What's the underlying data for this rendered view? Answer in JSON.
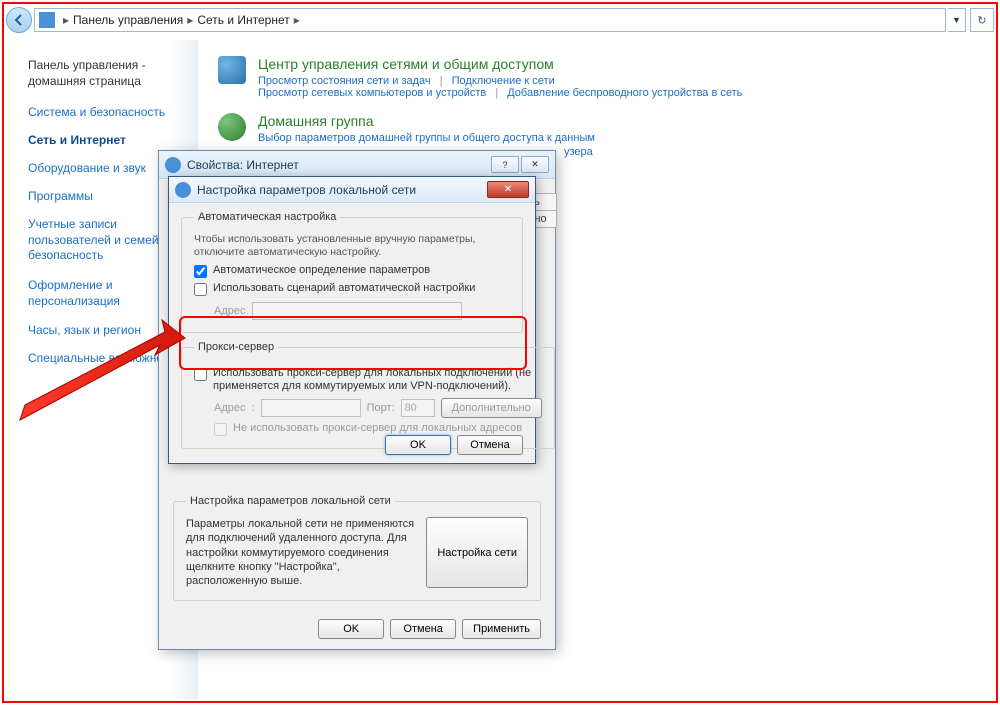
{
  "breadcrumb": {
    "seg1": "Панель управления",
    "seg2": "Сеть и Интернет"
  },
  "sidebar": {
    "home_l1": "Панель управления -",
    "home_l2": "домашняя страница",
    "items": [
      "Система и безопасность",
      "Сеть и Интернет",
      "Оборудование и звук",
      "Программы",
      "Учетные записи пользователей и семейная безопасность",
      "Оформление и персонализация",
      "Часы, язык и регион",
      "Специальные возможности"
    ]
  },
  "content": {
    "network": {
      "title": "Центр управления сетями и общим доступом",
      "link1": "Просмотр состояния сети и задач",
      "link2": "Подключение к сети",
      "link3": "Просмотр сетевых компьютеров и устройств",
      "link4": "Добавление беспроводного устройства в сеть"
    },
    "homegroup": {
      "title": "Домашняя группа",
      "link1": "Выбор параметров домашней группы и общего доступа к данным"
    },
    "faux_tab1": "ть",
    "faux_tab2": "льно",
    "faux_tab3": "узера"
  },
  "dialog": {
    "title": "Свойства: Интернет",
    "lan_group_title": "Настройка параметров локальной сети",
    "lan_text": "Параметры локальной сети не применяются для подключений удаленного доступа. Для настройки коммутируемого соединения щелкните кнопку \"Настройка\", расположенную выше.",
    "lan_btn": "Настройка сети",
    "ok": "OK",
    "cancel": "Отмена",
    "apply": "Применить"
  },
  "lan": {
    "title": "Настройка параметров локальной сети",
    "auto_legend": "Автоматическая настройка",
    "auto_note": "Чтобы использовать установленные вручную параметры, отключите автоматическую настройку.",
    "auto_detect": "Автоматическое определение параметров",
    "use_script": "Использовать сценарий автоматической настройки",
    "address_label": "Адрес",
    "proxy_legend": "Прокси-сервер",
    "use_proxy": "Использовать прокси-сервер для локальных подключений (не применяется для коммутируемых или VPN-подключений).",
    "port_label": "Порт:",
    "port_value": "80",
    "advanced": "Дополнительно",
    "bypass_local": "Не использовать прокси-сервер для локальных адресов",
    "ok": "OK",
    "cancel": "Отмена"
  }
}
